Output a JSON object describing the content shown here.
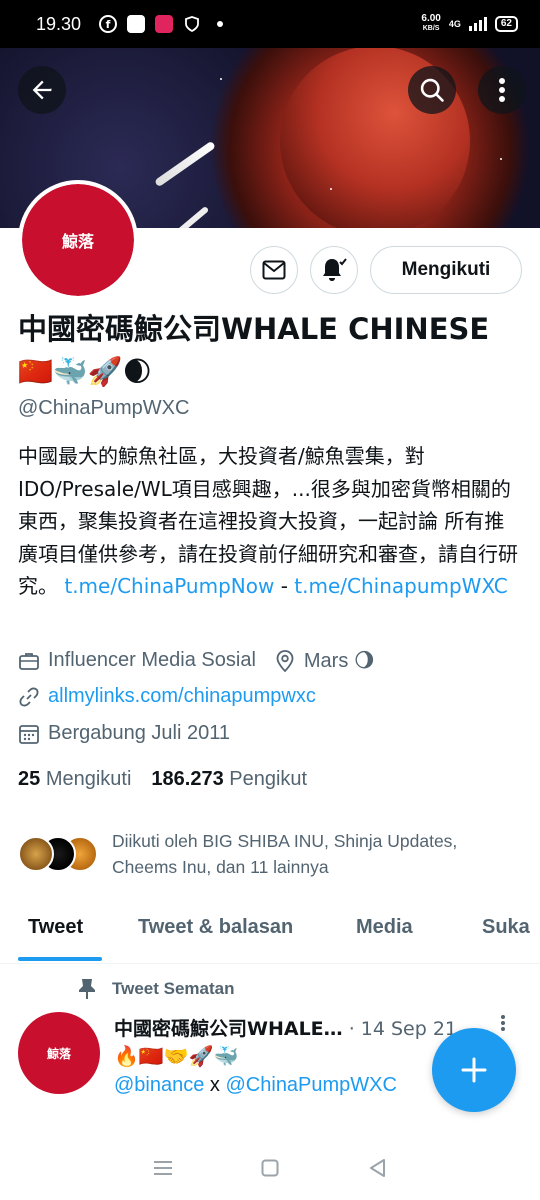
{
  "status_bar": {
    "time": "19.30",
    "speed_value": "6.00",
    "speed_unit": "KB/S",
    "network": "4G",
    "battery": "62"
  },
  "profile": {
    "display_name": "中國密碼鯨公司WHALE CHINESE",
    "name_emoji": "🇨🇳🐳🚀🌒",
    "handle": "@ChinaPumpWXC",
    "bio_text": "中國最大的鯨魚社區，大投資者/鯨魚雲集，對IDO/Presale/WL項目感興趣，...很多與加密貨幣相關的東西，聚集投資者在這裡投資大投資，一起討論 所有推廣項目僅供參考，請在投資前仔細研究和審查，請自行研究。",
    "bio_link1": "t.me/ChinaPumpNow",
    "bio_sep": " - ",
    "bio_link2": "t.me/ChinapumpWXC",
    "category": "Influencer Media Sosial",
    "location": "Mars 🌖",
    "website": "allmylinks.com/chinapumpwxc",
    "joined": "Bergabung Juli 2011",
    "following_count": "25",
    "following_label": "Mengikuti",
    "followers_count": "186.273",
    "followers_label": "Pengikut",
    "followed_by": "Diikuti oleh BIG SHIBA INU, Shinja Updates, Cheems Inu, dan 11 lainnya"
  },
  "actions": {
    "follow_label": "Mengikuti"
  },
  "tabs": [
    {
      "label": "Tweet"
    },
    {
      "label": "Tweet & balasan"
    },
    {
      "label": "Media"
    },
    {
      "label": "Suka"
    }
  ],
  "pinned_tweet": {
    "pinned_label": "Tweet Sematan",
    "author": "中國密碼鯨公司WHALE…",
    "date": "· 14 Sep 21",
    "emoji": "🔥🇨🇳🤝🚀🐳",
    "mention1": "@binance",
    "connector": " x ",
    "mention2": "@ChinaPumpWXC"
  },
  "avatar_text": "鯨落",
  "colors": {
    "accent": "#1d9bf0",
    "text": "#0f1419",
    "muted": "#536471",
    "avatar_red": "#c8102e"
  },
  "icons": [
    "back-arrow-icon",
    "search-icon",
    "more-vertical-icon",
    "mail-icon",
    "bell-plus-icon",
    "briefcase-icon",
    "location-pin-icon",
    "link-icon",
    "calendar-icon",
    "pin-icon",
    "plus-icon"
  ]
}
